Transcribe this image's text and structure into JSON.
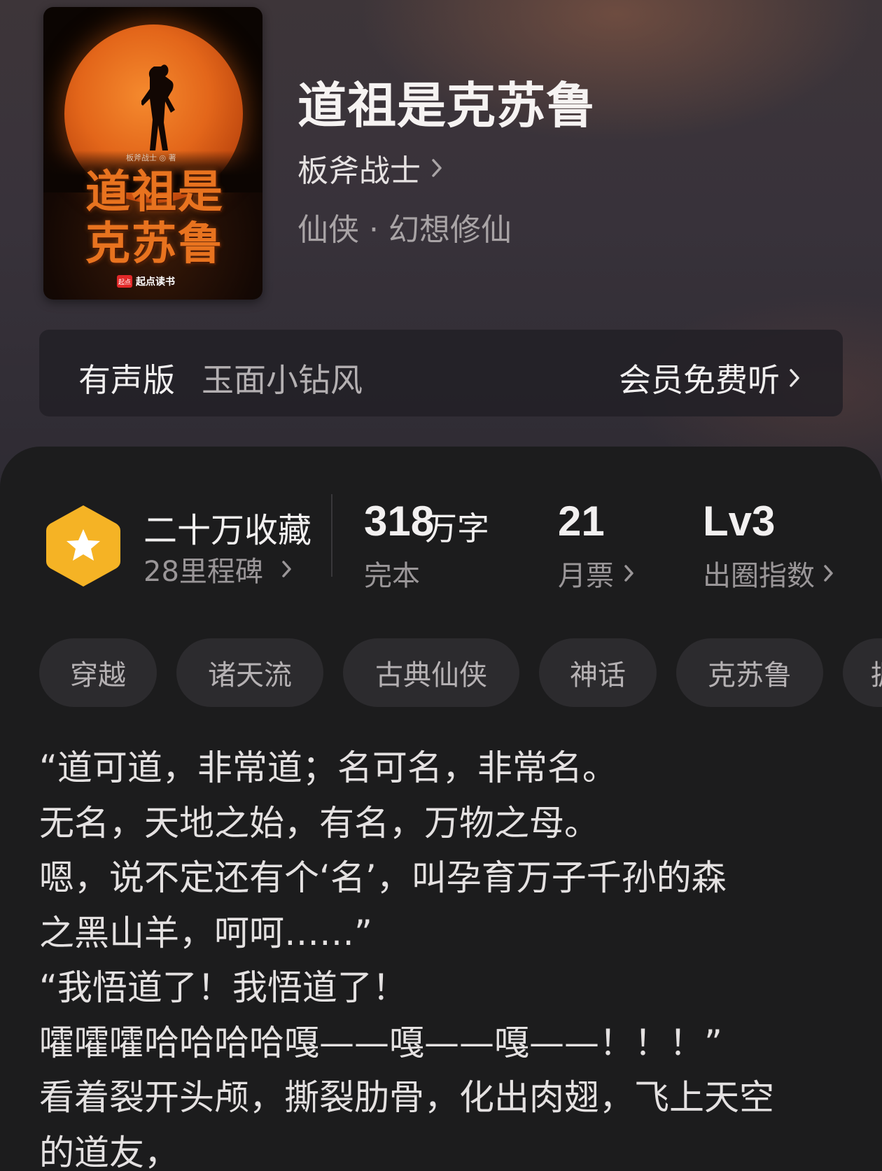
{
  "book": {
    "cover": {
      "author_small": "板斧战士 ◎ 著",
      "title_lines": [
        "道祖是",
        "克苏鲁"
      ],
      "publisher_logo": "起点",
      "publisher": "起点读书"
    },
    "title": "道祖是克苏鲁",
    "author": "板斧战士",
    "genre": "仙侠 · 幻想修仙"
  },
  "audio": {
    "label": "有声版",
    "narrator": "玉面小钻风",
    "cta": "会员免费听"
  },
  "stats": {
    "collect": {
      "title": "二十万收藏",
      "milestone": "28里程碑"
    },
    "words": {
      "number": "318",
      "unit": "万字",
      "status": "完本"
    },
    "votes": {
      "number": "21",
      "label": "月票"
    },
    "index": {
      "number": "Lv3",
      "label": "出圈指数"
    }
  },
  "tags": [
    "穿越",
    "诸天流",
    "古典仙侠",
    "神话",
    "克苏鲁",
    "据"
  ],
  "synopsis": [
    "“道可道，非常道；名可名，非常名。",
    "无名，天地之始，有名，万物之母。",
    "嗯，说不定还有个‘名’，叫孕育万子千孙的森",
    "之黑山羊，呵呵……”",
    "“我悟道了！我悟道了！",
    "嚯嚯嚯哈哈哈哈嘎——嘎——嘎——！！！”",
    "看着裂开头颅，撕裂肋骨，化出肉翅，飞上天空",
    "的道友，"
  ],
  "colors": {
    "badge_gold": "#f5b325",
    "panel_bg": "#1c1c1d",
    "tag_bg": "#2c2b2e"
  },
  "icons": [
    "star-hexagon-icon",
    "chevron-right-icon"
  ]
}
